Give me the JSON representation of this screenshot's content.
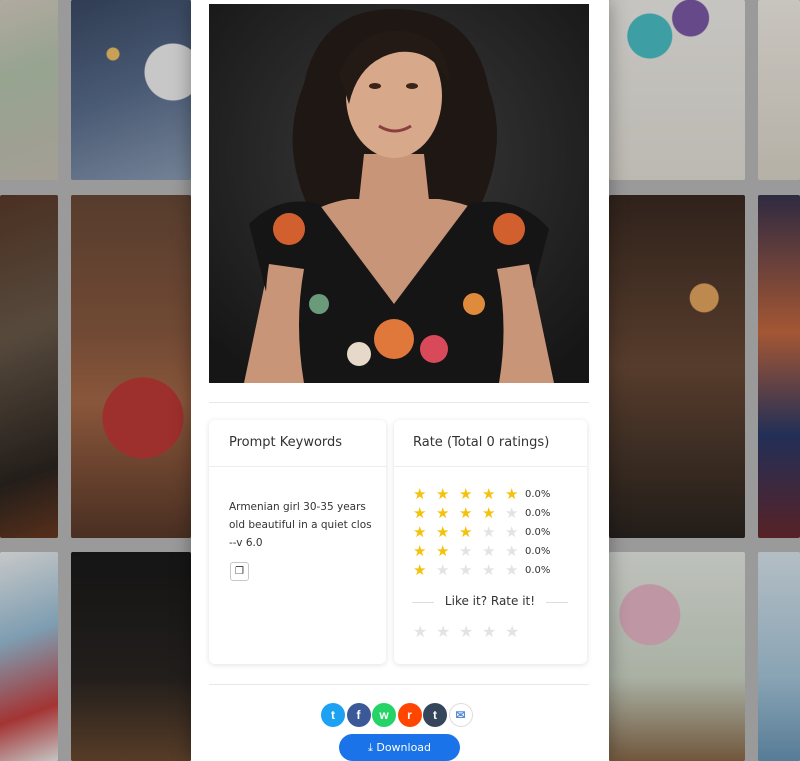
{
  "keywords_card": {
    "title": "Prompt Keywords",
    "prompt": "Armenian girl 30-35 years old beautiful in a quiet clos --v 6.0",
    "copy_icon": "copy-icon"
  },
  "rating_card": {
    "title": "Rate (Total 0 ratings)",
    "rows": [
      {
        "stars": 5,
        "percent": "0.0%"
      },
      {
        "stars": 4,
        "percent": "0.0%"
      },
      {
        "stars": 3,
        "percent": "0.0%"
      },
      {
        "stars": 2,
        "percent": "0.0%"
      },
      {
        "stars": 1,
        "percent": "0.0%"
      }
    ],
    "cta": "Like it? Rate it!",
    "user_rating": 0,
    "max_stars": 5
  },
  "share": {
    "buttons": [
      {
        "name": "twitter",
        "glyph": "t",
        "color": "#1da1f2"
      },
      {
        "name": "facebook",
        "glyph": "f",
        "color": "#3b5998"
      },
      {
        "name": "whatsapp",
        "glyph": "w",
        "color": "#25d366"
      },
      {
        "name": "reddit",
        "glyph": "r",
        "color": "#ff4500"
      },
      {
        "name": "tumblr",
        "glyph": "t",
        "color": "#35465c"
      },
      {
        "name": "email",
        "glyph": "✉",
        "color": "#ffffff"
      }
    ]
  },
  "download": {
    "label": "Download",
    "icon": "download-icon"
  },
  "colors": {
    "accent": "#1a73e8",
    "star": "#f4c20d"
  }
}
